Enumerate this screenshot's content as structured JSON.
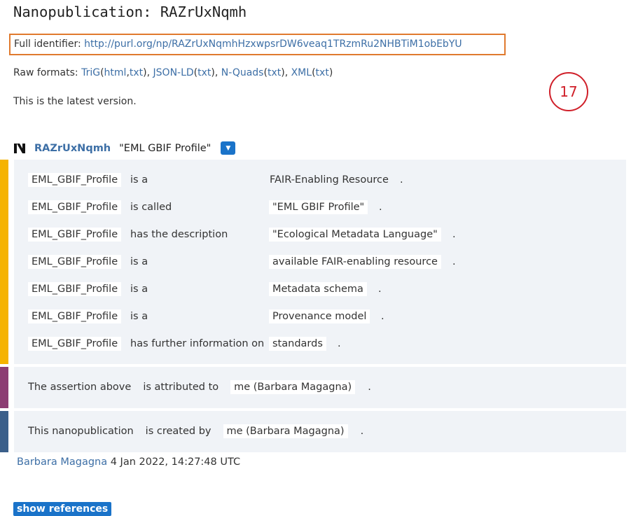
{
  "header": {
    "title": "Nanopublication: RAZrUxNqmh"
  },
  "identifier": {
    "label": "Full identifier:",
    "url": "http://purl.org/np/RAZrUxNqmhHzxwpsrDW6veaq1TRzmRu2NHBTiM1obEbYU"
  },
  "raw_formats": {
    "label": "Raw formats:",
    "formats": [
      {
        "name": "TriG",
        "subs": [
          "html",
          "txt"
        ]
      },
      {
        "name": "JSON-LD",
        "subs": [
          "txt"
        ]
      },
      {
        "name": "N-Quads",
        "subs": [
          "txt"
        ]
      },
      {
        "name": "XML",
        "subs": [
          "txt"
        ]
      }
    ]
  },
  "version_note": "This is the latest version.",
  "badge_number": "17",
  "nanopub": {
    "id": "RAZrUxNqmh",
    "label": "\"EML GBIF Profile\""
  },
  "assertion": [
    {
      "s": "EML_GBIF_Profile",
      "p": "is a",
      "o": "FAIR-Enabling Resource",
      "o_boxed": false
    },
    {
      "s": "EML_GBIF_Profile",
      "p": "is called",
      "o": "\"EML GBIF Profile\"",
      "o_boxed": true
    },
    {
      "s": "EML_GBIF_Profile",
      "p": "has the description",
      "o": "\"Ecological Metadata Language\"",
      "o_boxed": true
    },
    {
      "s": "EML_GBIF_Profile",
      "p": "is a",
      "o": "available FAIR-enabling resource",
      "o_boxed": true
    },
    {
      "s": "EML_GBIF_Profile",
      "p": "is a",
      "o": "Metadata schema",
      "o_boxed": true
    },
    {
      "s": "EML_GBIF_Profile",
      "p": "is a",
      "o": "Provenance model",
      "o_boxed": true
    },
    {
      "s": "EML_GBIF_Profile",
      "p": "has further information on",
      "o": "standards",
      "o_boxed": true
    }
  ],
  "provenance": {
    "s": "The assertion above",
    "p": "is attributed to",
    "o": "me (Barbara Magagna)"
  },
  "pubinfo": {
    "s": "This nanopublication",
    "p": "is created by",
    "o": "me (Barbara Magagna)"
  },
  "footer": {
    "author": "Barbara Magagna",
    "date": "4 Jan 2022, 14:27:48 UTC"
  },
  "show_references_label": "show references",
  "colors": {
    "assertion_bar": "#f5b301",
    "provenance_bar": "#8c3d73",
    "pubinfo_bar": "#3b5f8a",
    "link": "#3d6fa6",
    "highlight_border": "#e07a2e",
    "badge": "#d0202a"
  },
  "icons": {
    "nanopub_logo": "nanopub-logo-icon",
    "dropdown": "chevron-down-icon"
  }
}
